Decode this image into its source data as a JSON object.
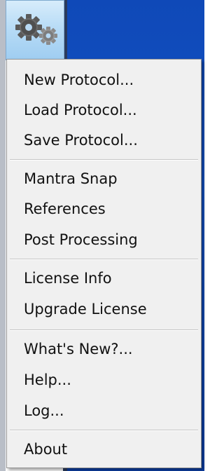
{
  "toolbar": {
    "icon": "gears-icon"
  },
  "menu": {
    "items": [
      {
        "label": "New Protocol..."
      },
      {
        "label": "Load Protocol..."
      },
      {
        "label": "Save Protocol..."
      },
      {
        "label": "Mantra Snap"
      },
      {
        "label": "References"
      },
      {
        "label": "Post Processing"
      },
      {
        "label": "License Info"
      },
      {
        "label": "Upgrade License"
      },
      {
        "label": "What's New?..."
      },
      {
        "label": "Help..."
      },
      {
        "label": "Log..."
      },
      {
        "label": "About"
      }
    ]
  }
}
